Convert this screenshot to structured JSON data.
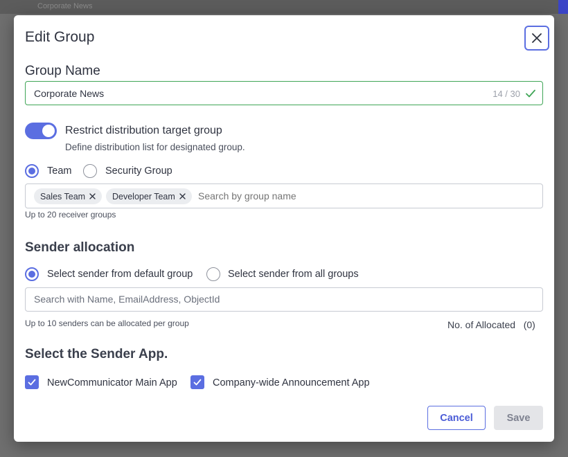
{
  "backdrop": {
    "title": "Corporate News"
  },
  "dialog": {
    "title": "Edit Group",
    "close_icon": "close-icon"
  },
  "group_name": {
    "label": "Group Name",
    "value": "Corporate News",
    "char_count": "14 / 30",
    "max_length": 30,
    "valid_icon": "checkmark-icon",
    "valid_color": "#3fa556"
  },
  "restrict": {
    "enabled": true,
    "label": "Restrict distribution target group",
    "description": "Define distribution list for designated group."
  },
  "target_type": {
    "options": [
      {
        "label": "Team",
        "selected": true
      },
      {
        "label": "Security Group",
        "selected": false
      }
    ]
  },
  "receiver_groups": {
    "chips": [
      {
        "label": "Sales Team"
      },
      {
        "label": "Developer Team"
      }
    ],
    "search_placeholder": "Search by group name",
    "hint": "Up to 20 receiver groups"
  },
  "sender_allocation": {
    "heading": "Sender allocation",
    "options": [
      {
        "label": "Select sender from default group",
        "selected": true
      },
      {
        "label": "Select sender from all groups",
        "selected": false
      }
    ],
    "search_placeholder": "Search with Name, EmailAddress, ObjectId",
    "hint": "Up to 10 senders can be allocated per group",
    "allocated_text": "No. of Allocated   (0)"
  },
  "sender_app": {
    "heading": "Select the Sender App.",
    "options": [
      {
        "label": "NewCommunicator Main App",
        "checked": true
      },
      {
        "label": "Company-wide Announcement App",
        "checked": true
      }
    ]
  },
  "footer": {
    "cancel_label": "Cancel",
    "save_label": "Save"
  },
  "colors": {
    "accent": "#5b6ee1",
    "valid": "#3fa556",
    "disabled_bg": "#e4e5e8"
  }
}
